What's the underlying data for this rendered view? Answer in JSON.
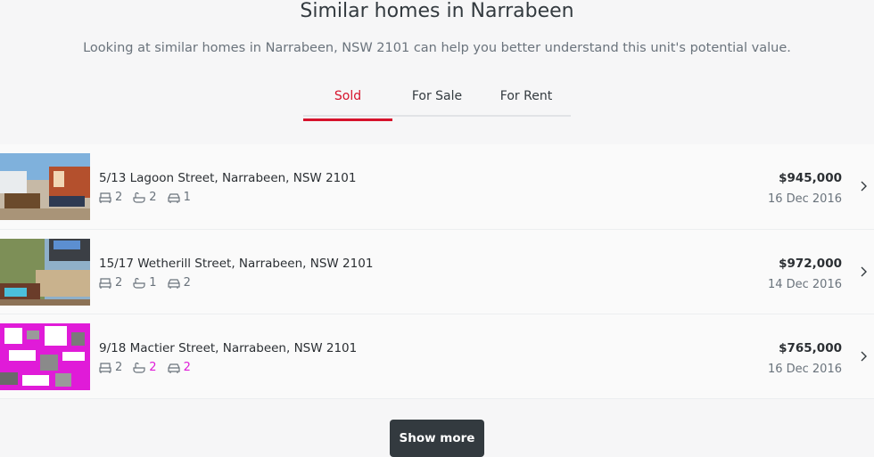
{
  "section": {
    "title": "Similar homes in Narrabeen",
    "subtitle": "Looking at similar homes in Narrabeen, NSW 2101 can help you better understand this unit's potential value."
  },
  "tabs": [
    {
      "label": "Sold",
      "active": true
    },
    {
      "label": "For Sale",
      "active": false
    },
    {
      "label": "For Rent",
      "active": false
    }
  ],
  "listings": [
    {
      "address": "5/13 Lagoon Street, Narrabeen, NSW 2101",
      "beds": "2",
      "baths": "2",
      "cars": "1",
      "price": "$945,000",
      "date": "16 Dec 2016"
    },
    {
      "address": "15/17 Wetherill Street, Narrabeen, NSW 2101",
      "beds": "2",
      "baths": "1",
      "cars": "2",
      "price": "$972,000",
      "date": "14 Dec 2016"
    },
    {
      "address": "9/18 Mactier Street, Narrabeen, NSW 2101",
      "beds": "2",
      "baths": "2",
      "cars": "2",
      "price": "$765,000",
      "date": "16 Dec 2016"
    }
  ],
  "actions": {
    "show_more": "Show more"
  },
  "colors": {
    "accent": "#d6122b",
    "button_bg": "#333a3f",
    "glitch": "#e01bd8"
  },
  "icons": {
    "bed": "bed-icon",
    "bath": "bath-icon",
    "car": "car-icon",
    "chevron": "chevron-right-icon"
  }
}
